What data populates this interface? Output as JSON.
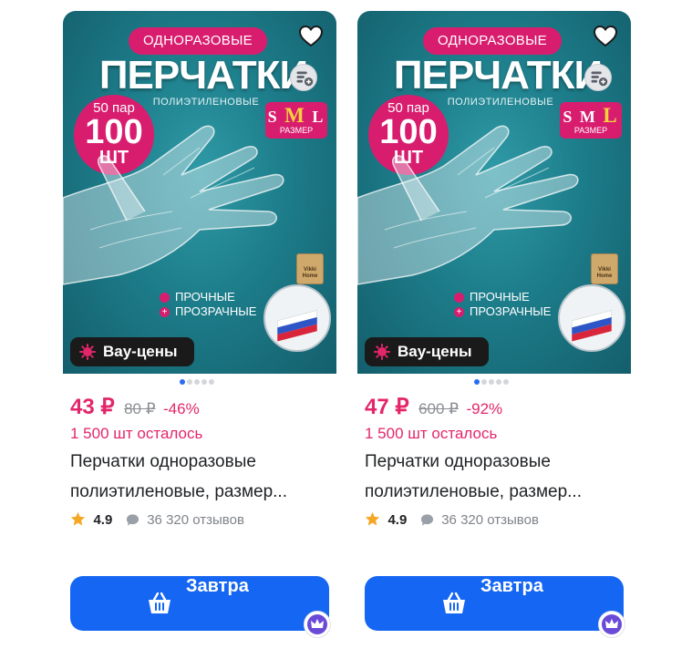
{
  "colors": {
    "accent": "#e3266a",
    "badge_pink": "#d81d6f",
    "button_blue": "#1566f2",
    "photo_teal": "#1d7d8a",
    "dot_active": "#2a6df4"
  },
  "icons": [
    "heart-icon",
    "compare-icon",
    "wow-sale-icon",
    "star-icon",
    "chat-icon",
    "basket-icon",
    "crown-icon"
  ],
  "products": [
    {
      "image": {
        "pill": "ОДНОРАЗОВЫЕ",
        "headline": "ПЕРЧАТКИ",
        "subline": "ПОЛИЭТИЛЕНОВЫЕ",
        "badge_top": "50 пар",
        "badge_big": "100",
        "badge_bottom": "ШТ",
        "size_s": "S",
        "size_m": "M",
        "size_l": "L",
        "size_word": "РАЗМЕР",
        "feature_1": "ПРОЧНЫЕ",
        "feature_2": "ПРОЗРАЧНЫЕ",
        "brand": "Vikki Home",
        "wow_label": "Вау-цены"
      },
      "carousel": {
        "count": 5,
        "active": 0
      },
      "price": "43 ₽",
      "old_price": "80 ₽",
      "discount": "-46%",
      "stock": "1 500 шт осталось",
      "title_line1": "Перчатки одноразовые",
      "title_line2": "полиэтиленовые, размер...",
      "rating": "4.9",
      "reviews": "36 320 отзывов",
      "cart_label": "Завтра"
    },
    {
      "image": {
        "pill": "ОДНОРАЗОВЫЕ",
        "headline": "ПЕРЧАТКИ",
        "subline": "ПОЛИЭТИЛЕНОВЫЕ",
        "badge_top": "50 пар",
        "badge_big": "100",
        "badge_bottom": "ШТ",
        "size_s": "S",
        "size_m": "M",
        "size_l": "L",
        "size_word": "РАЗМЕР",
        "feature_1": "ПРОЧНЫЕ",
        "feature_2": "ПРОЗРАЧНЫЕ",
        "brand": "Vikki Home",
        "wow_label": "Вау-цены"
      },
      "carousel": {
        "count": 5,
        "active": 0
      },
      "price": "47 ₽",
      "old_price": "600 ₽",
      "discount": "-92%",
      "stock": "1 500 шт осталось",
      "title_line1": "Перчатки одноразовые",
      "title_line2": "полиэтиленовые, размер...",
      "rating": "4.9",
      "reviews": "36 320 отзывов",
      "cart_label": "Завтра"
    }
  ]
}
